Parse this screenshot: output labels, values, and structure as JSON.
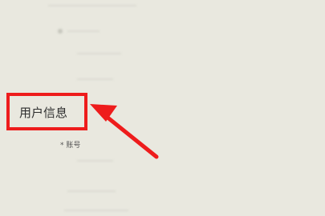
{
  "highlight": {
    "label": "用户信息",
    "color": "#ee1c1c"
  },
  "sub_label": "* 账号",
  "blurred_rows": [
    "",
    "",
    "",
    "",
    "",
    ""
  ]
}
